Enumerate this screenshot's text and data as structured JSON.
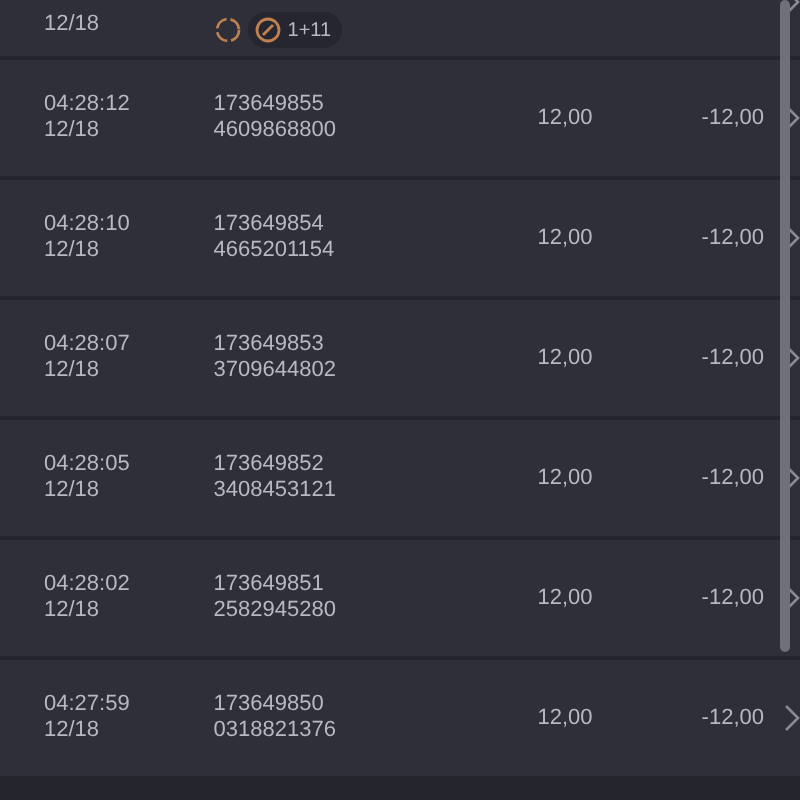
{
  "rows": [
    {
      "kind": "partial",
      "date": "12/18",
      "badge": "1+11"
    },
    {
      "kind": "full",
      "time": "04:28:12",
      "date": "12/18",
      "id": "173649855",
      "ref": "4609868800",
      "stake": "12,00",
      "result": "-12,00"
    },
    {
      "kind": "full",
      "time": "04:28:10",
      "date": "12/18",
      "id": "173649854",
      "ref": "4665201154",
      "stake": "12,00",
      "result": "-12,00"
    },
    {
      "kind": "full",
      "time": "04:28:07",
      "date": "12/18",
      "id": "173649853",
      "ref": "3709644802",
      "stake": "12,00",
      "result": "-12,00"
    },
    {
      "kind": "full",
      "time": "04:28:05",
      "date": "12/18",
      "id": "173649852",
      "ref": "3408453121",
      "stake": "12,00",
      "result": "-12,00"
    },
    {
      "kind": "full",
      "time": "04:28:02",
      "date": "12/18",
      "id": "173649851",
      "ref": "2582945280",
      "stake": "12,00",
      "result": "-12,00"
    },
    {
      "kind": "full",
      "time": "04:27:59",
      "date": "12/18",
      "id": "173649850",
      "ref": "0318821376",
      "stake": "12,00",
      "result": "-12,00"
    }
  ]
}
